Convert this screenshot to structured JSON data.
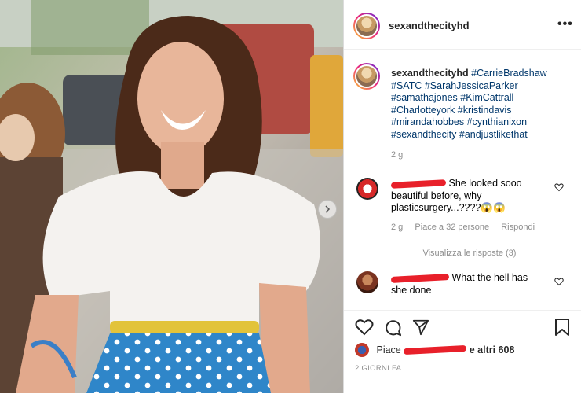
{
  "post": {
    "username": "sexandthecityhd",
    "more_icon": "more-dots-icon",
    "caption_user": "sexandthecityhd",
    "caption_tags": [
      "#CarrieBradshaw",
      "#SATC",
      "#SarahJessicaParker",
      "#samathajones",
      "#KimCattrall",
      "#Charlotteyork",
      "#kristindavis",
      "#mirandahobbes",
      "#cynthianixon",
      "#sexandthecity",
      "#andjustlikethat"
    ],
    "caption_time": "2 g"
  },
  "comments": [
    {
      "text_line1": "She looked sooo",
      "text_line2": "beautiful before, why",
      "text_line3": "plasticsurgery...????",
      "emoji": "😱😱",
      "meta_time": "2 g",
      "meta_likes": "Piace a 32 persone",
      "meta_reply": "Rispondi",
      "view_replies": "Visualizza le risposte (3)"
    },
    {
      "text_line1": "What the hell has",
      "text_line2": "she done"
    }
  ],
  "likes": {
    "prefix": "Piace",
    "suffix": "e altri 608"
  },
  "timestamp": "2 GIORNI FA",
  "colors": {
    "accent_link": "#00376b",
    "muted": "#8e8e8e",
    "scribble": "#e8202a"
  }
}
